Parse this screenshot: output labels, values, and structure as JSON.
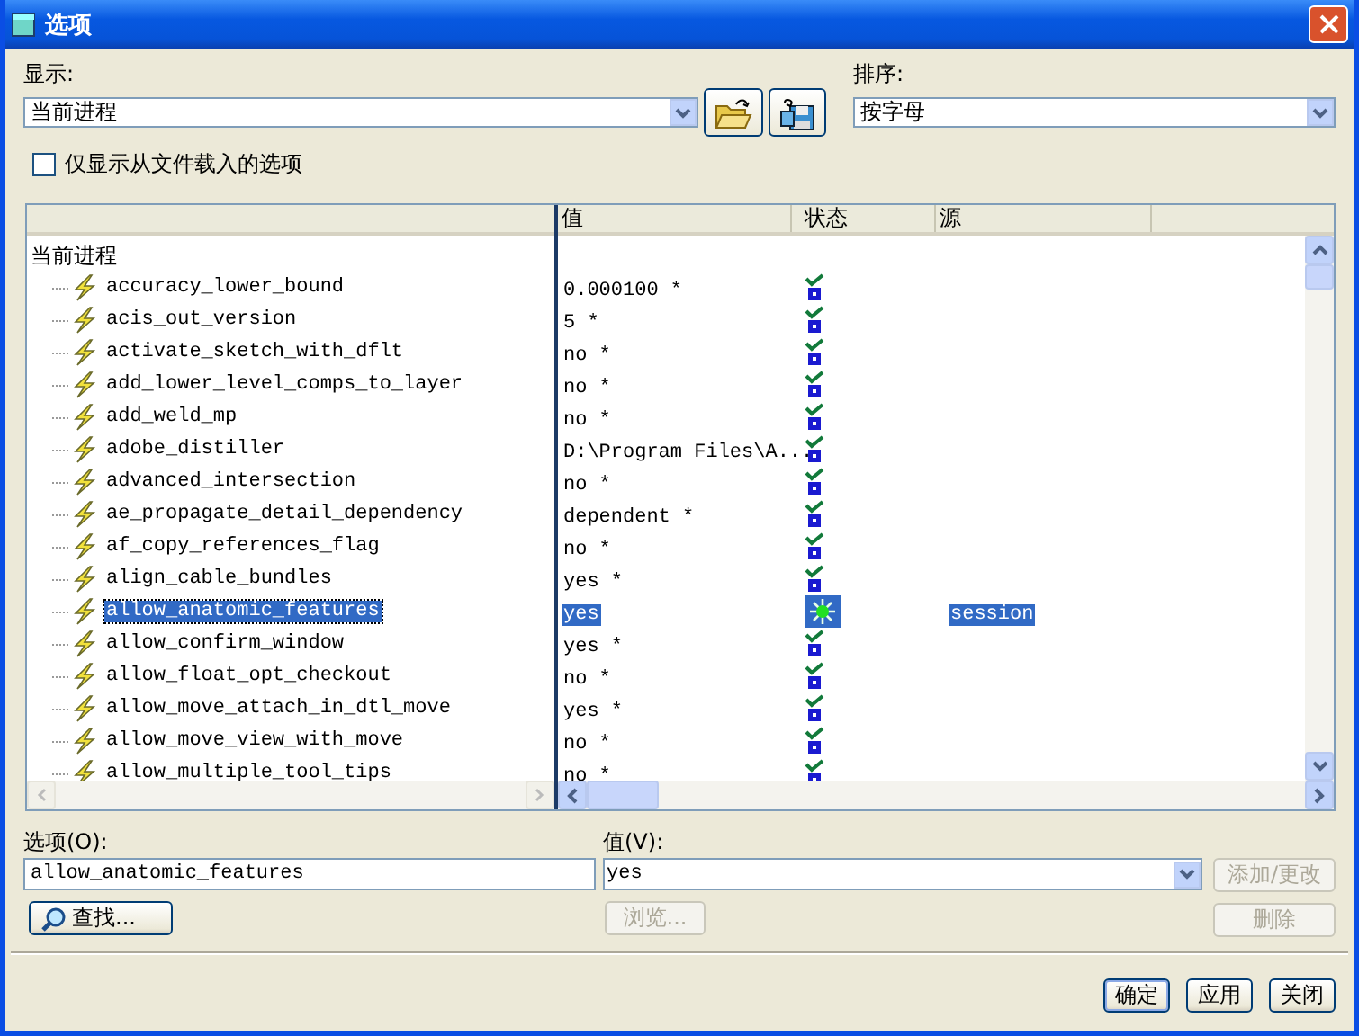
{
  "window": {
    "title": "选项"
  },
  "display": {
    "label": "显示:",
    "value": "当前进程"
  },
  "sort": {
    "label": "排序:",
    "value": "按字母"
  },
  "file_only": {
    "label": "仅显示从文件载入的选项",
    "checked": false
  },
  "table": {
    "columns": [
      "值",
      "状态",
      "源"
    ],
    "group": "当前进程",
    "rows": [
      {
        "name": "accuracy_lower_bound",
        "value": "0.000100 *",
        "kind": "default",
        "selected": false
      },
      {
        "name": "acis_out_version",
        "value": "5 *",
        "kind": "default",
        "selected": false
      },
      {
        "name": "activate_sketch_with_dflt",
        "value": "no *",
        "kind": "default",
        "selected": false
      },
      {
        "name": "add_lower_level_comps_to_layer",
        "value": "no *",
        "kind": "default",
        "selected": false
      },
      {
        "name": "add_weld_mp",
        "value": "no *",
        "kind": "default",
        "selected": false
      },
      {
        "name": "adobe_distiller",
        "value": "D:\\Program Files\\A...",
        "kind": "default",
        "selected": false
      },
      {
        "name": "advanced_intersection",
        "value": "no *",
        "kind": "default",
        "selected": false
      },
      {
        "name": "ae_propagate_detail_dependency",
        "value": "dependent *",
        "kind": "default",
        "selected": false
      },
      {
        "name": "af_copy_references_flag",
        "value": "no *",
        "kind": "default",
        "selected": false
      },
      {
        "name": "align_cable_bundles",
        "value": "yes *",
        "kind": "default",
        "selected": false
      },
      {
        "name": "allow_anatomic_features",
        "value": "yes",
        "kind": "set",
        "source": "session",
        "selected": true
      },
      {
        "name": "allow_confirm_window",
        "value": "yes *",
        "kind": "default",
        "selected": false
      },
      {
        "name": "allow_float_opt_checkout",
        "value": "no *",
        "kind": "default",
        "selected": false
      },
      {
        "name": "allow_move_attach_in_dtl_move",
        "value": "yes *",
        "kind": "default",
        "selected": false
      },
      {
        "name": "allow_move_view_with_move",
        "value": "no *",
        "kind": "default",
        "selected": false
      },
      {
        "name": "allow_multiple_tool_tips",
        "value": "no *",
        "kind": "default",
        "selected": false
      }
    ]
  },
  "option": {
    "label": "选项(O):",
    "value": "allow_anatomic_features"
  },
  "value_field": {
    "label": "值(V):",
    "value": "yes"
  },
  "find_button": {
    "label": "查找..."
  },
  "add_button": {
    "label": "添加/更改",
    "disabled": true
  },
  "browse_button": {
    "label": "浏览...",
    "disabled": true
  },
  "delete_button": {
    "label": "删除",
    "disabled": true
  },
  "dialog_buttons": [
    {
      "label": "确定",
      "default": true
    },
    {
      "label": "应用",
      "default": false
    },
    {
      "label": "关闭",
      "default": false
    }
  ]
}
